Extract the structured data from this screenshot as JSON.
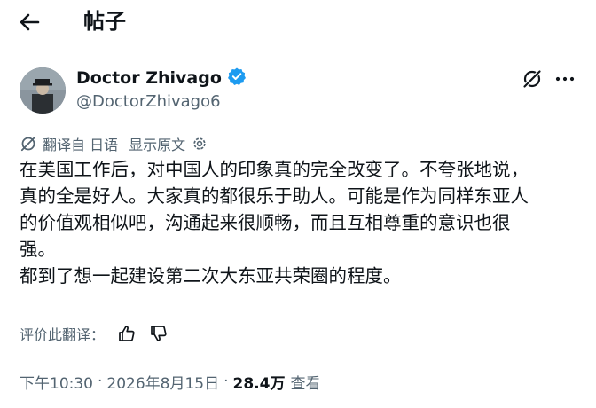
{
  "header": {
    "title": "帖子"
  },
  "author": {
    "display_name": "Doctor Zhivago",
    "handle": "@DoctorZhivago6"
  },
  "translation": {
    "label": "翻译自 日语",
    "show_original": "显示原文"
  },
  "post": {
    "lines": [
      "在美国工作后，对中国人的印象真的完全改变了。不夸张地说，",
      "真的全是好人。大家真的都很乐于助人。可能是作为同样东亚人",
      "的价值观相似吧，沟通起来很顺畅，而且互相尊重的意识也很",
      "强。",
      "都到了想一起建设第二次大东亚共荣圈的程度。"
    ]
  },
  "rate_translation": {
    "label": "评价此翻译："
  },
  "meta": {
    "time": "下午10:30",
    "separator": "·",
    "date": "2026年8月15日",
    "views_count": "28.4万",
    "views_label": "查看"
  },
  "colors": {
    "text_primary": "#0f1419",
    "text_secondary": "#536471",
    "verified_blue": "#1d9bf0"
  },
  "icons": [
    "back-arrow-icon",
    "verified-badge-icon",
    "grok-icon",
    "more-icon",
    "translate-icon",
    "settings-icon",
    "thumbs-up-icon",
    "thumbs-down-icon"
  ]
}
